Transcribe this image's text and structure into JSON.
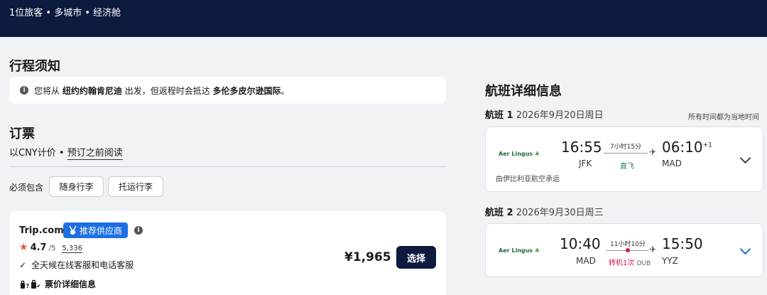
{
  "header": {
    "summary": "1位旅客 • 多城市 • 经济舱"
  },
  "notice": {
    "title": "行程须知",
    "info_icon": "info-icon",
    "prefix": "您将从",
    "origin": "纽约约翰肯尼迪",
    "middle": "出发，但返程时会抵达",
    "destination": "多伦多皮尔逊国际",
    "suffix": "。"
  },
  "booking": {
    "title": "订票",
    "currency_text": "以CNY计价",
    "separator": "•",
    "read_before_link": "预订之前阅读",
    "includes_label": "必须包含",
    "options": [
      "随身行李",
      "托运行李"
    ]
  },
  "vendor": {
    "name": "Trip.com",
    "badge": "推荐供应商",
    "badge_icon": "medal-icon",
    "rating": "4.7",
    "rating_out_of": "/5",
    "review_count": "5,336",
    "support": "全天候在线客服和电话客服",
    "fare_detail": "票价详细信息",
    "price": "¥1,965",
    "select_label": "选择"
  },
  "details": {
    "title": "航班详细信息",
    "timezone_note": "所有时间都为当地时间",
    "flights": [
      {
        "label": "航班 1",
        "date": "2026年9月20日周日",
        "airline": "Aer Lingus",
        "depart_time": "16:55",
        "depart_code": "JFK",
        "duration": "7小时15分",
        "stops": "直飞",
        "arrive_time": "06:10",
        "arrive_offset": "+1",
        "arrive_code": "MAD",
        "operated_by": "由伊比利亚航空承运"
      },
      {
        "label": "航班 2",
        "date": "2026年9月30日周三",
        "airline": "Aer Lingus",
        "depart_time": "10:40",
        "depart_code": "MAD",
        "duration": "11小时10分",
        "stops": "转机1次",
        "via": "DUB",
        "arrive_time": "15:50",
        "arrive_code": "YYZ"
      }
    ]
  },
  "colors": {
    "navy": "#0c1b3e",
    "accent_blue": "#1d6fe3",
    "stop_pink": "#d6175d",
    "direct_green": "#1f7a63"
  }
}
